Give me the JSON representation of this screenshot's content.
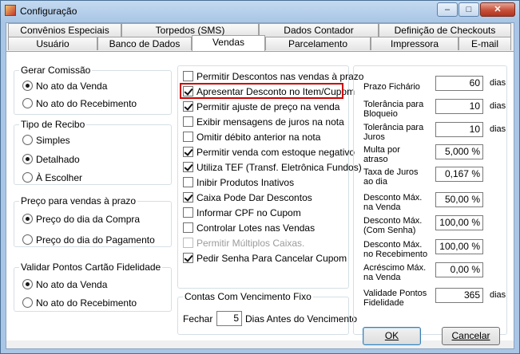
{
  "window": {
    "title": "Configuração"
  },
  "tabs_row1": [
    "Convênios Especiais",
    "Torpedos (SMS)",
    "Dados Contador",
    "Definição de Checkouts"
  ],
  "tabs_row2": [
    "Usuário",
    "Banco de Dados",
    "Vendas",
    "Parcelamento",
    "Impressora",
    "E-mail"
  ],
  "active_tab": "Vendas",
  "gerar_comissao": {
    "title": "Gerar Comissão",
    "options": [
      {
        "label": "No ato da Venda",
        "selected": true
      },
      {
        "label": "No ato do Recebimento",
        "selected": false
      }
    ]
  },
  "tipo_recibo": {
    "title": "Tipo de Recibo",
    "options": [
      {
        "label": "Simples",
        "selected": false
      },
      {
        "label": "Detalhado",
        "selected": true
      },
      {
        "label": "À Escolher",
        "selected": false
      }
    ]
  },
  "preco_prazo": {
    "title": "Preço para vendas à prazo",
    "options": [
      {
        "label": "Preço do dia da Compra",
        "selected": true
      },
      {
        "label": "Preço do dia do Pagamento",
        "selected": false
      }
    ]
  },
  "pontos_fidelidade": {
    "title": "Validar Pontos Cartão Fidelidade",
    "options": [
      {
        "label": "No ato da Venda",
        "selected": true
      },
      {
        "label": "No ato do Recebimento",
        "selected": false
      }
    ]
  },
  "checkboxes": [
    {
      "label": "Permitir Descontos nas vendas à prazo",
      "checked": false,
      "enabled": true
    },
    {
      "label": "Apresentar Desconto no Item/Cupom",
      "checked": true,
      "enabled": true
    },
    {
      "label": "Permitir ajuste de preço na venda",
      "checked": true,
      "enabled": true
    },
    {
      "label": "Exibir mensagens de juros na nota",
      "checked": false,
      "enabled": true
    },
    {
      "label": "Omitir débito anterior na nota",
      "checked": false,
      "enabled": true
    },
    {
      "label": "Permitir venda com estoque negativo",
      "checked": true,
      "enabled": true
    },
    {
      "label": "Utiliza TEF (Transf. Eletrônica Fundos)",
      "checked": true,
      "enabled": true
    },
    {
      "label": "Inibir Produtos Inativos",
      "checked": false,
      "enabled": true
    },
    {
      "label": "Caixa Pode Dar Descontos",
      "checked": true,
      "enabled": true
    },
    {
      "label": "Informar CPF no Cupom",
      "checked": false,
      "enabled": true
    },
    {
      "label": "Controlar Lotes nas Vendas",
      "checked": false,
      "enabled": true
    },
    {
      "label": "Permitir Múltiplos Caixas.",
      "checked": false,
      "enabled": false
    },
    {
      "label": "Pedir Senha Para Cancelar Cupom",
      "checked": true,
      "enabled": true
    }
  ],
  "contas_vencimento": {
    "title": "Contas Com Vencimento Fixo",
    "prefix": "Fechar",
    "value": "5",
    "suffix": "Dias Antes do Vencimento"
  },
  "fields": [
    {
      "label": "Prazo Fichário",
      "value": "60",
      "unit": "dias"
    },
    {
      "label": "Tolerância para\nBloqueio",
      "value": "10",
      "unit": "dias"
    },
    {
      "label": "Tolerância para\nJuros",
      "value": "10",
      "unit": "dias"
    },
    {
      "label": "Multa por\natraso",
      "value": "5,000 %",
      "unit": ""
    },
    {
      "label": "Taxa de Juros\nao dia",
      "value": "0,167 %",
      "unit": ""
    },
    {
      "label": "Desconto Máx.\nna Venda",
      "value": "50,00 %",
      "unit": ""
    },
    {
      "label": "Desconto Máx.\n(Com Senha)",
      "value": "100,00 %",
      "unit": ""
    },
    {
      "label": "Desconto Máx.\nno Recebimento",
      "value": "100,00 %",
      "unit": ""
    },
    {
      "label": "Acréscimo Máx.\nna Venda",
      "value": "0,00 %",
      "unit": ""
    },
    {
      "label": "Validade Pontos\nFidelidade",
      "value": "365",
      "unit": "dias"
    }
  ],
  "buttons": {
    "ok": "OK",
    "cancel": "Cancelar"
  },
  "titlebar_buttons": {
    "minimize": "–",
    "maximize": "□",
    "close": "✕"
  }
}
